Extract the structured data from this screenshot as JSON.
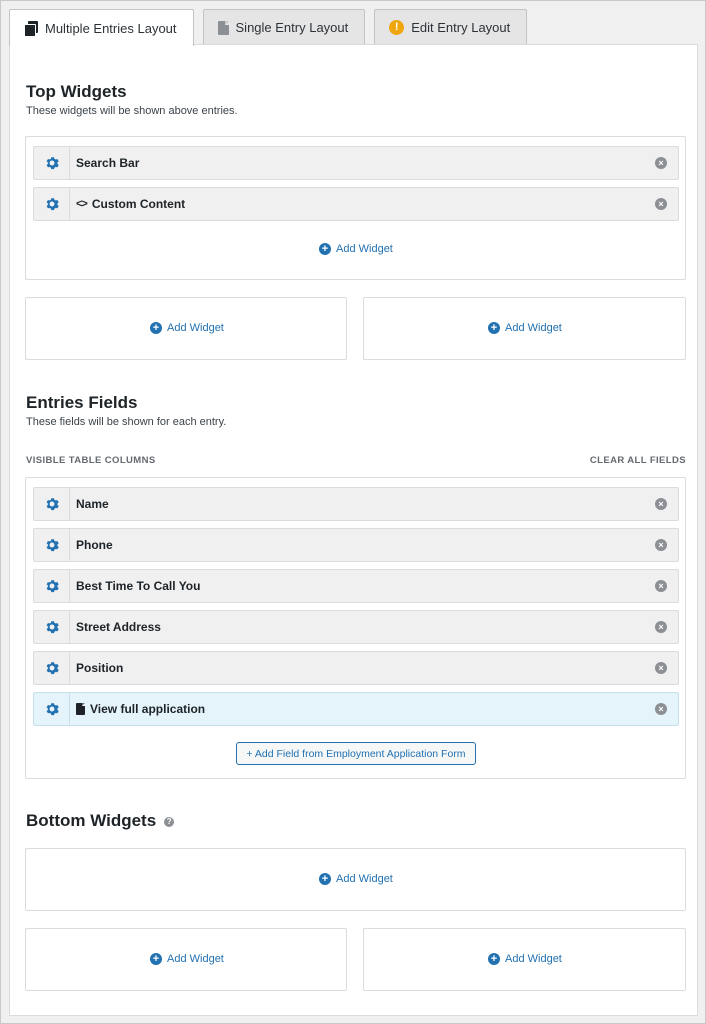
{
  "tabs": [
    {
      "label": "Multiple Entries Layout",
      "icon": "multiple-entries-icon",
      "active": true
    },
    {
      "label": "Single Entry Layout",
      "icon": "single-entry-icon",
      "active": false
    },
    {
      "label": "Edit Entry Layout",
      "icon": "warning-icon",
      "active": false
    }
  ],
  "top_widgets": {
    "title": "Top Widgets",
    "description": "These widgets will be shown above entries.",
    "items": [
      {
        "label": "Search Bar"
      },
      {
        "label": "Custom Content"
      }
    ],
    "add_widget_label": "Add Widget",
    "left_add_label": "Add Widget",
    "right_add_label": "Add Widget"
  },
  "entries_fields": {
    "title": "Entries Fields",
    "description": "These fields will be shown for each entry.",
    "columns_label": "VISIBLE TABLE COLUMNS",
    "clear_label": "CLEAR ALL FIELDS",
    "fields": [
      {
        "label": "Name"
      },
      {
        "label": "Phone"
      },
      {
        "label": "Best Time To Call You"
      },
      {
        "label": "Street Address"
      },
      {
        "label": "Position"
      },
      {
        "label": "View full application"
      }
    ],
    "add_field_label": "+ Add Field from Employment Application Form"
  },
  "bottom_widgets": {
    "title": "Bottom Widgets",
    "help": "?",
    "add_widget_label": "Add Widget",
    "left_add_label": "Add Widget",
    "right_add_label": "Add Widget"
  },
  "colors": {
    "accent": "#2271b1",
    "highlight_row": "#e5f4fa",
    "row_bg": "#f0f0f1",
    "warning": "#f0a60f"
  }
}
